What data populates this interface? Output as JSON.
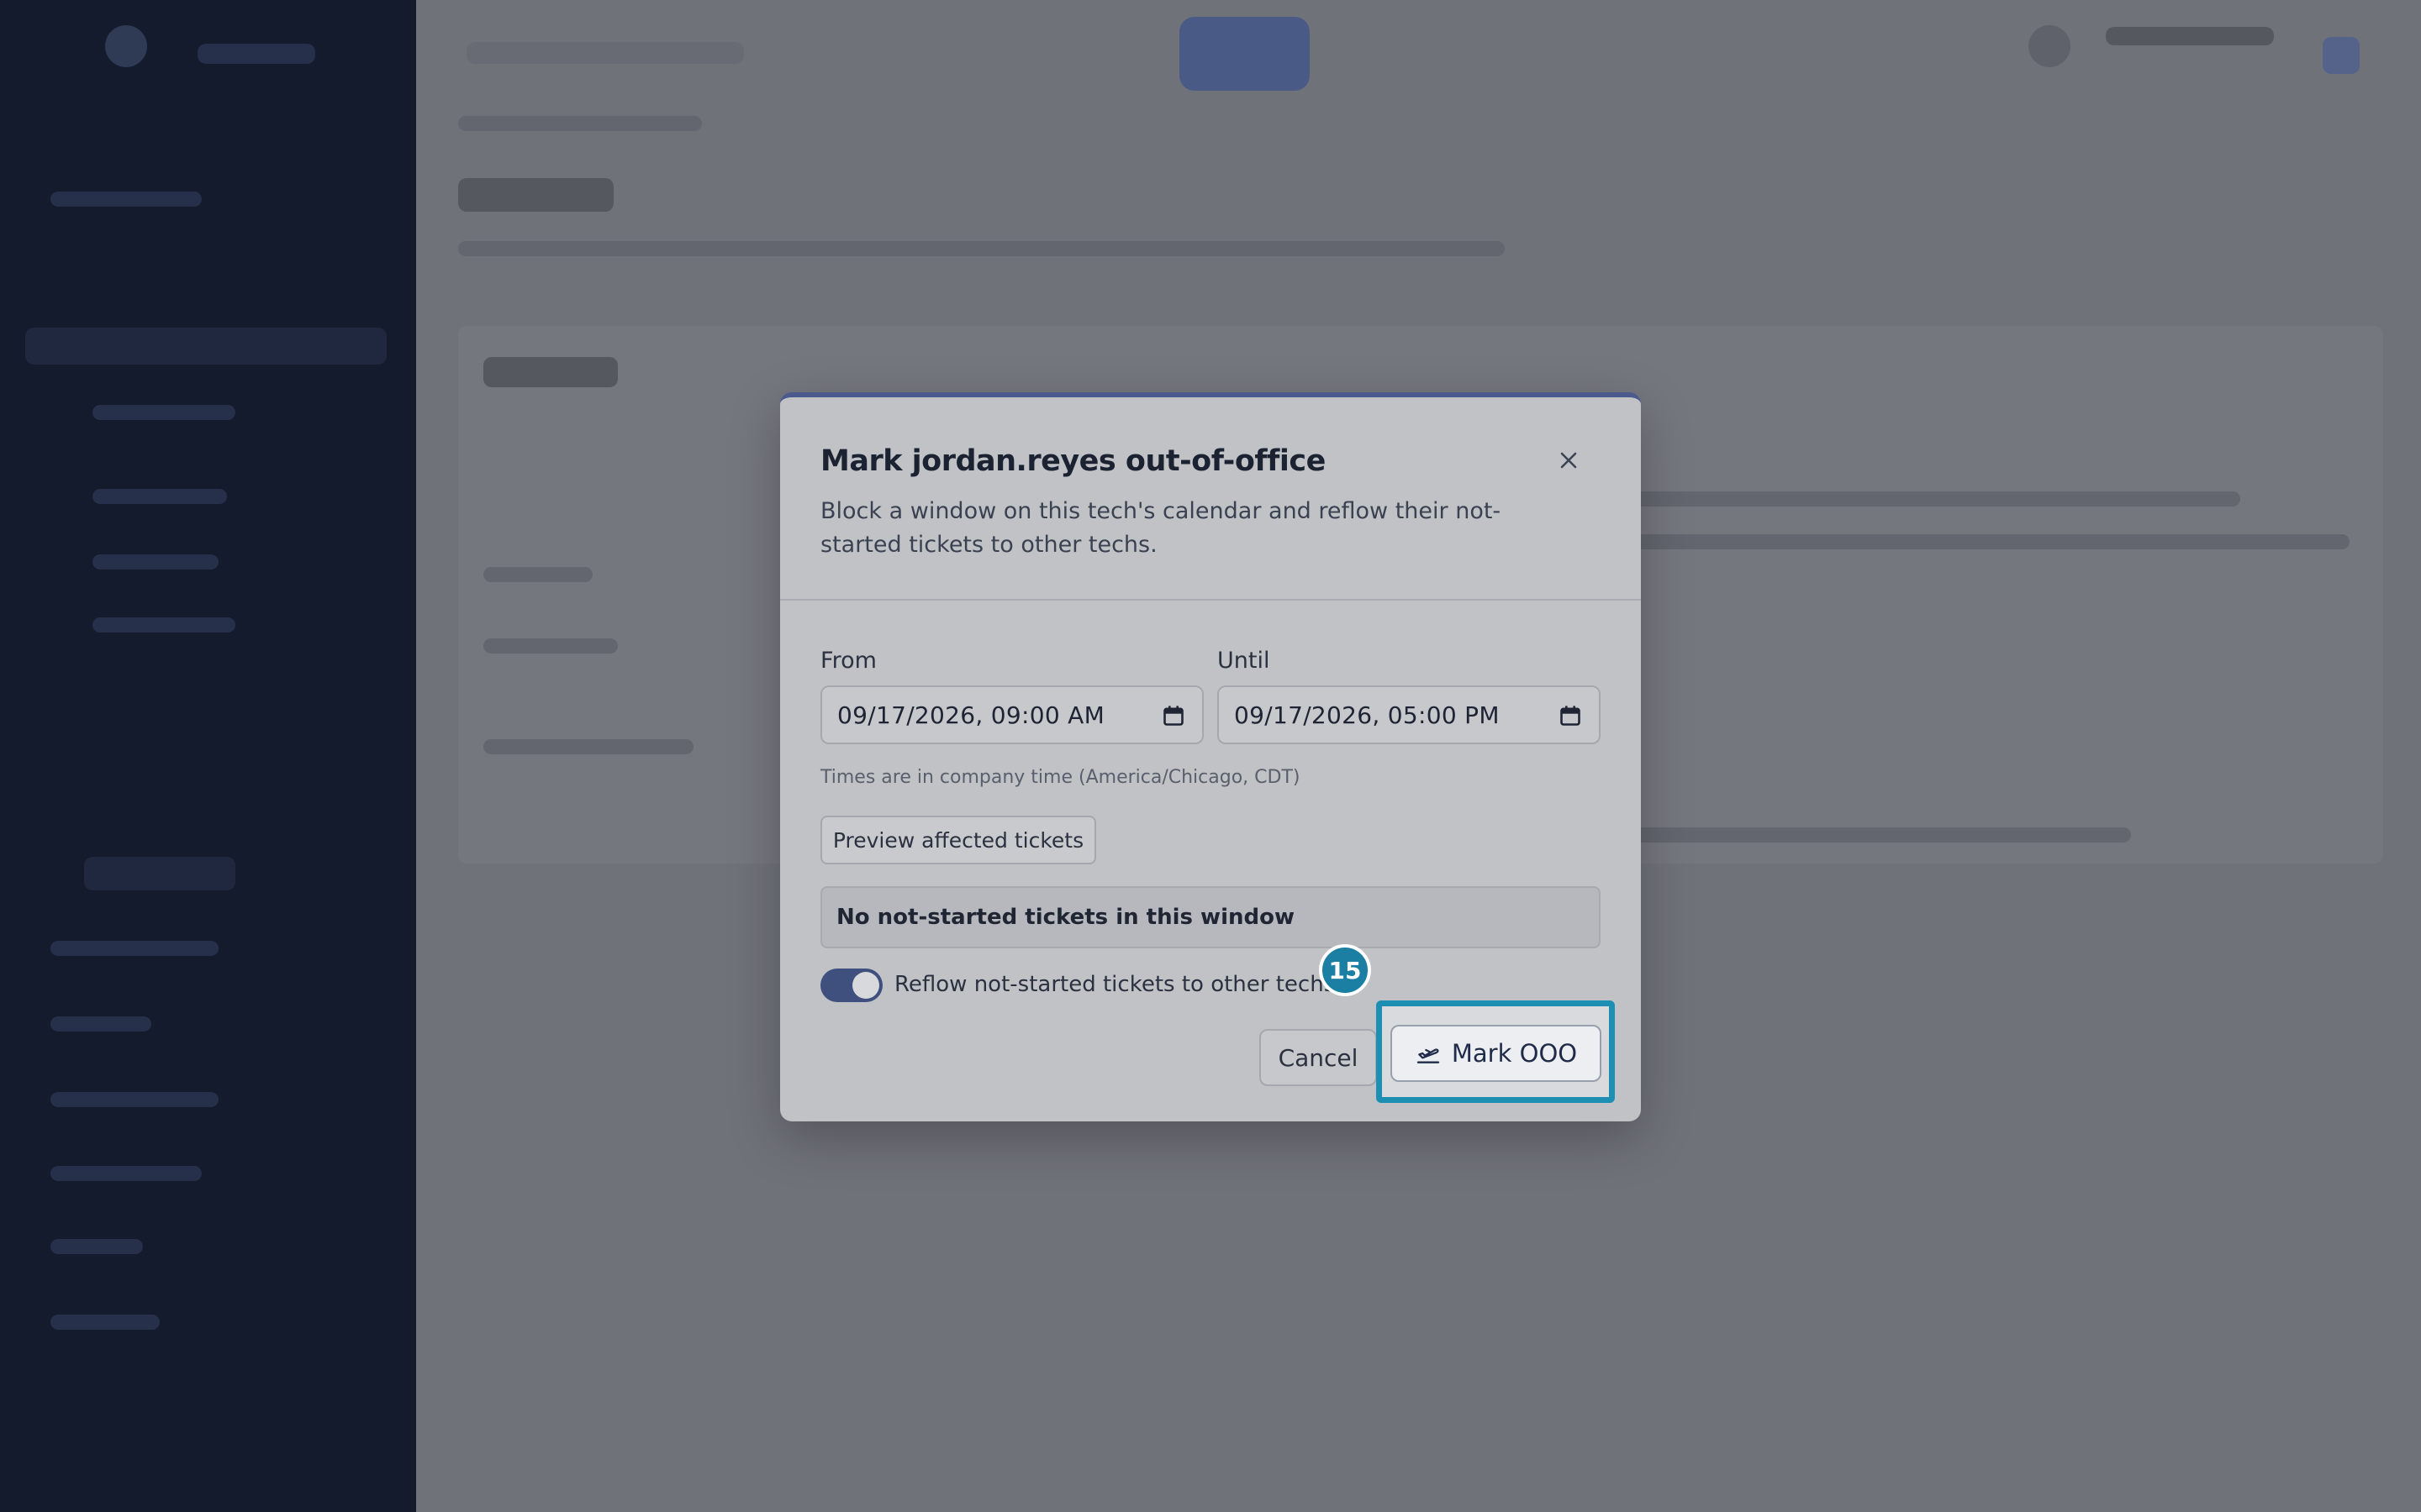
{
  "modal": {
    "title": "Mark jordan.reyes out-of-office",
    "description": "Block a window on this tech's calendar and reflow their not-started tickets to other techs.",
    "from_label": "From",
    "from_value": "09/17/2026, 09:00 AM",
    "until_label": "Until",
    "until_value": "09/17/2026, 05:00 PM",
    "timezone_note": "Times are in company time (America/Chicago, CDT)",
    "preview_button": "Preview affected tickets",
    "status_message": "No not-started tickets in this window",
    "reflow_label": "Reflow not-started tickets to other techs",
    "reflow_enabled": true,
    "cancel_button": "Cancel",
    "submit_button": "Mark OOO"
  },
  "annotation": {
    "step_number": "15"
  },
  "colors": {
    "accent": "#3f4f7e",
    "highlight": "#1d8fb3",
    "sidebar": "#131b2d",
    "overlay": "#6f7176"
  },
  "icons": {
    "close": "close-icon",
    "calendar": "calendar-icon",
    "submit": "plane-takeoff-icon"
  }
}
